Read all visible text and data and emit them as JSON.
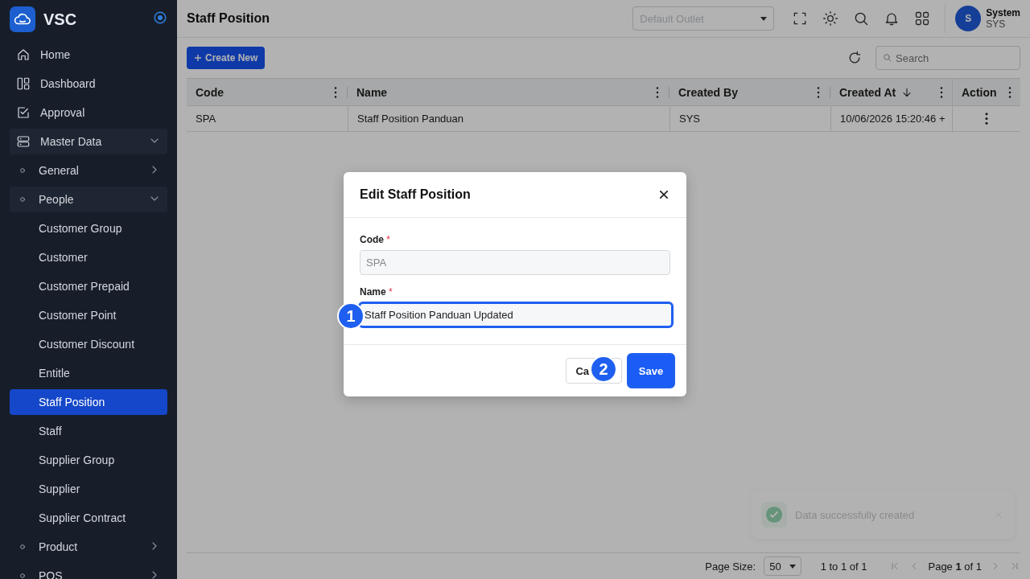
{
  "sidebar": {
    "brand": "VSC",
    "items": [
      {
        "label": "Home",
        "selected": false
      },
      {
        "label": "Dashboard",
        "selected": false
      },
      {
        "label": "Approval",
        "selected": false
      },
      {
        "label": "Master Data",
        "selected": false,
        "expanded": true,
        "children": [
          {
            "label": "General",
            "selected": false,
            "expanded": false
          },
          {
            "label": "People",
            "selected": false,
            "expanded": true,
            "children": [
              {
                "label": "Customer Group",
                "selected": false
              },
              {
                "label": "Customer",
                "selected": false
              },
              {
                "label": "Customer Prepaid",
                "selected": false
              },
              {
                "label": "Customer Point",
                "selected": false
              },
              {
                "label": "Customer Discount",
                "selected": false
              },
              {
                "label": "Entitle",
                "selected": false
              },
              {
                "label": "Staff Position",
                "selected": true
              },
              {
                "label": "Staff",
                "selected": false
              },
              {
                "label": "Supplier Group",
                "selected": false
              },
              {
                "label": "Supplier",
                "selected": false
              },
              {
                "label": "Supplier Contract",
                "selected": false
              }
            ]
          },
          {
            "label": "Product",
            "selected": false,
            "expanded": false
          },
          {
            "label": "POS",
            "selected": false,
            "expanded": false
          }
        ]
      }
    ]
  },
  "header": {
    "title": "Staff Position",
    "outlet": {
      "placeholder": "Default Outlet"
    },
    "user": {
      "initial": "S",
      "name": "System",
      "code": "SYS"
    }
  },
  "toolbar": {
    "create_button": "Create New",
    "search": {
      "placeholder": "Search"
    }
  },
  "table": {
    "columns": [
      {
        "label": "Code",
        "sorted": false
      },
      {
        "label": "Name",
        "sorted": false
      },
      {
        "label": "Created By",
        "sorted": false
      },
      {
        "label": "Created At",
        "sorted": true
      },
      {
        "label": "Action",
        "sorted": false
      }
    ],
    "rows": [
      {
        "cells": [
          "SPA",
          "Staff Position Panduan",
          "SYS",
          "10/06/2026 15:20:46 +"
        ]
      }
    ]
  },
  "pagination": {
    "page_size_label": "Page Size:",
    "page_size": "50",
    "range": "1 to 1 of 1",
    "page": "Page **1** of 1"
  },
  "toast": {
    "kind": "success",
    "text": "Data successfully created"
  },
  "modal": {
    "title": "Edit Staff Position",
    "fields": [
      {
        "label": "Code",
        "required_mark": "*",
        "value": "SPA",
        "disabled": true,
        "focused": false
      },
      {
        "label": "Name",
        "required_mark": "*",
        "value": "Staff Position Panduan Updated",
        "disabled": false,
        "focused": true
      }
    ],
    "cancel_button": "Ca",
    "save_button": "Save",
    "steps": [
      "1",
      "2"
    ]
  }
}
